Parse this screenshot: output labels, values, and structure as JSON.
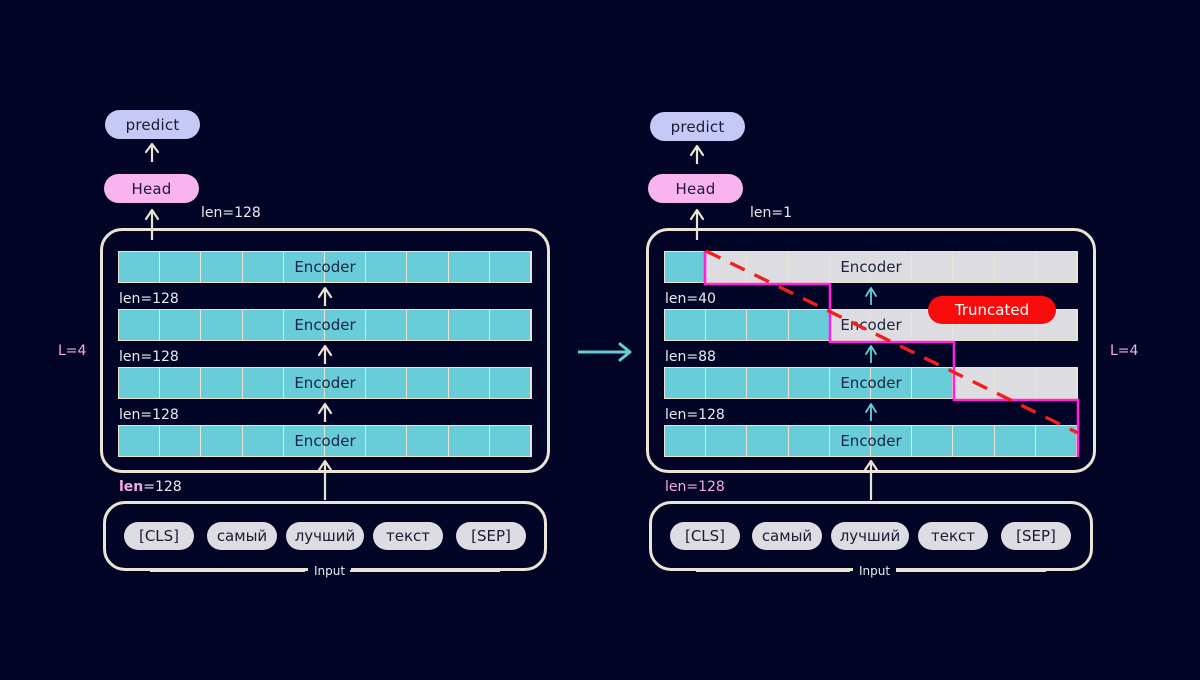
{
  "background": "#020526",
  "colors": {
    "accent_cyan": "#68cdd8",
    "inactive_gray": "#dddde1",
    "outline": "#e9e4d4",
    "pink": "#f6a9e4",
    "magenta_line": "#ff22dd",
    "red_dashed": "#f02020",
    "predict_fill": "#c6c9f5",
    "head_fill": "#f9b3ef",
    "badge_red": "#f70b0b"
  },
  "left_panel": {
    "title_predict": "predict",
    "title_head": "Head",
    "depth_label": "L=4",
    "top_len_label": "len=128",
    "encoder_label": "Encoder",
    "encoder_rows": [
      {
        "label": "Encoder",
        "len_below": "len=128",
        "active_cells": 10,
        "total_cells": 10
      },
      {
        "label": "Encoder",
        "len_below": "len=128",
        "active_cells": 10,
        "total_cells": 10
      },
      {
        "label": "Encoder",
        "len_below": "len=128",
        "active_cells": 10,
        "total_cells": 10
      },
      {
        "label": "Encoder",
        "len_below": "len=128",
        "active_cells": 10,
        "total_cells": 10
      }
    ],
    "input_len_prefix": "len",
    "input_len_suffix": "=128",
    "input_caption": "Input",
    "tokens": [
      "[CLS]",
      "самый",
      "лучший",
      "текст",
      "[SEP]"
    ]
  },
  "right_panel": {
    "title_predict": "predict",
    "title_head": "Head",
    "depth_label": "L=4",
    "top_len_label": "len=1",
    "encoder_label": "Encoder",
    "truncated_badge": "Truncated",
    "encoder_rows": [
      {
        "label": "Encoder",
        "len_below": "len=40",
        "active_cells": 1,
        "total_cells": 10
      },
      {
        "label": "Encoder",
        "len_below": "len=88",
        "active_cells": 4,
        "total_cells": 10
      },
      {
        "label": "Encoder",
        "len_below": "len=128",
        "active_cells": 7,
        "total_cells": 10
      },
      {
        "label": "Encoder",
        "len_below": "",
        "active_cells": 10,
        "total_cells": 10
      }
    ],
    "input_len_label": "len=128",
    "input_caption": "Input",
    "tokens": [
      "[CLS]",
      "самый",
      "лучший",
      "текст",
      "[SEP]"
    ]
  },
  "transition_arrow": "→"
}
